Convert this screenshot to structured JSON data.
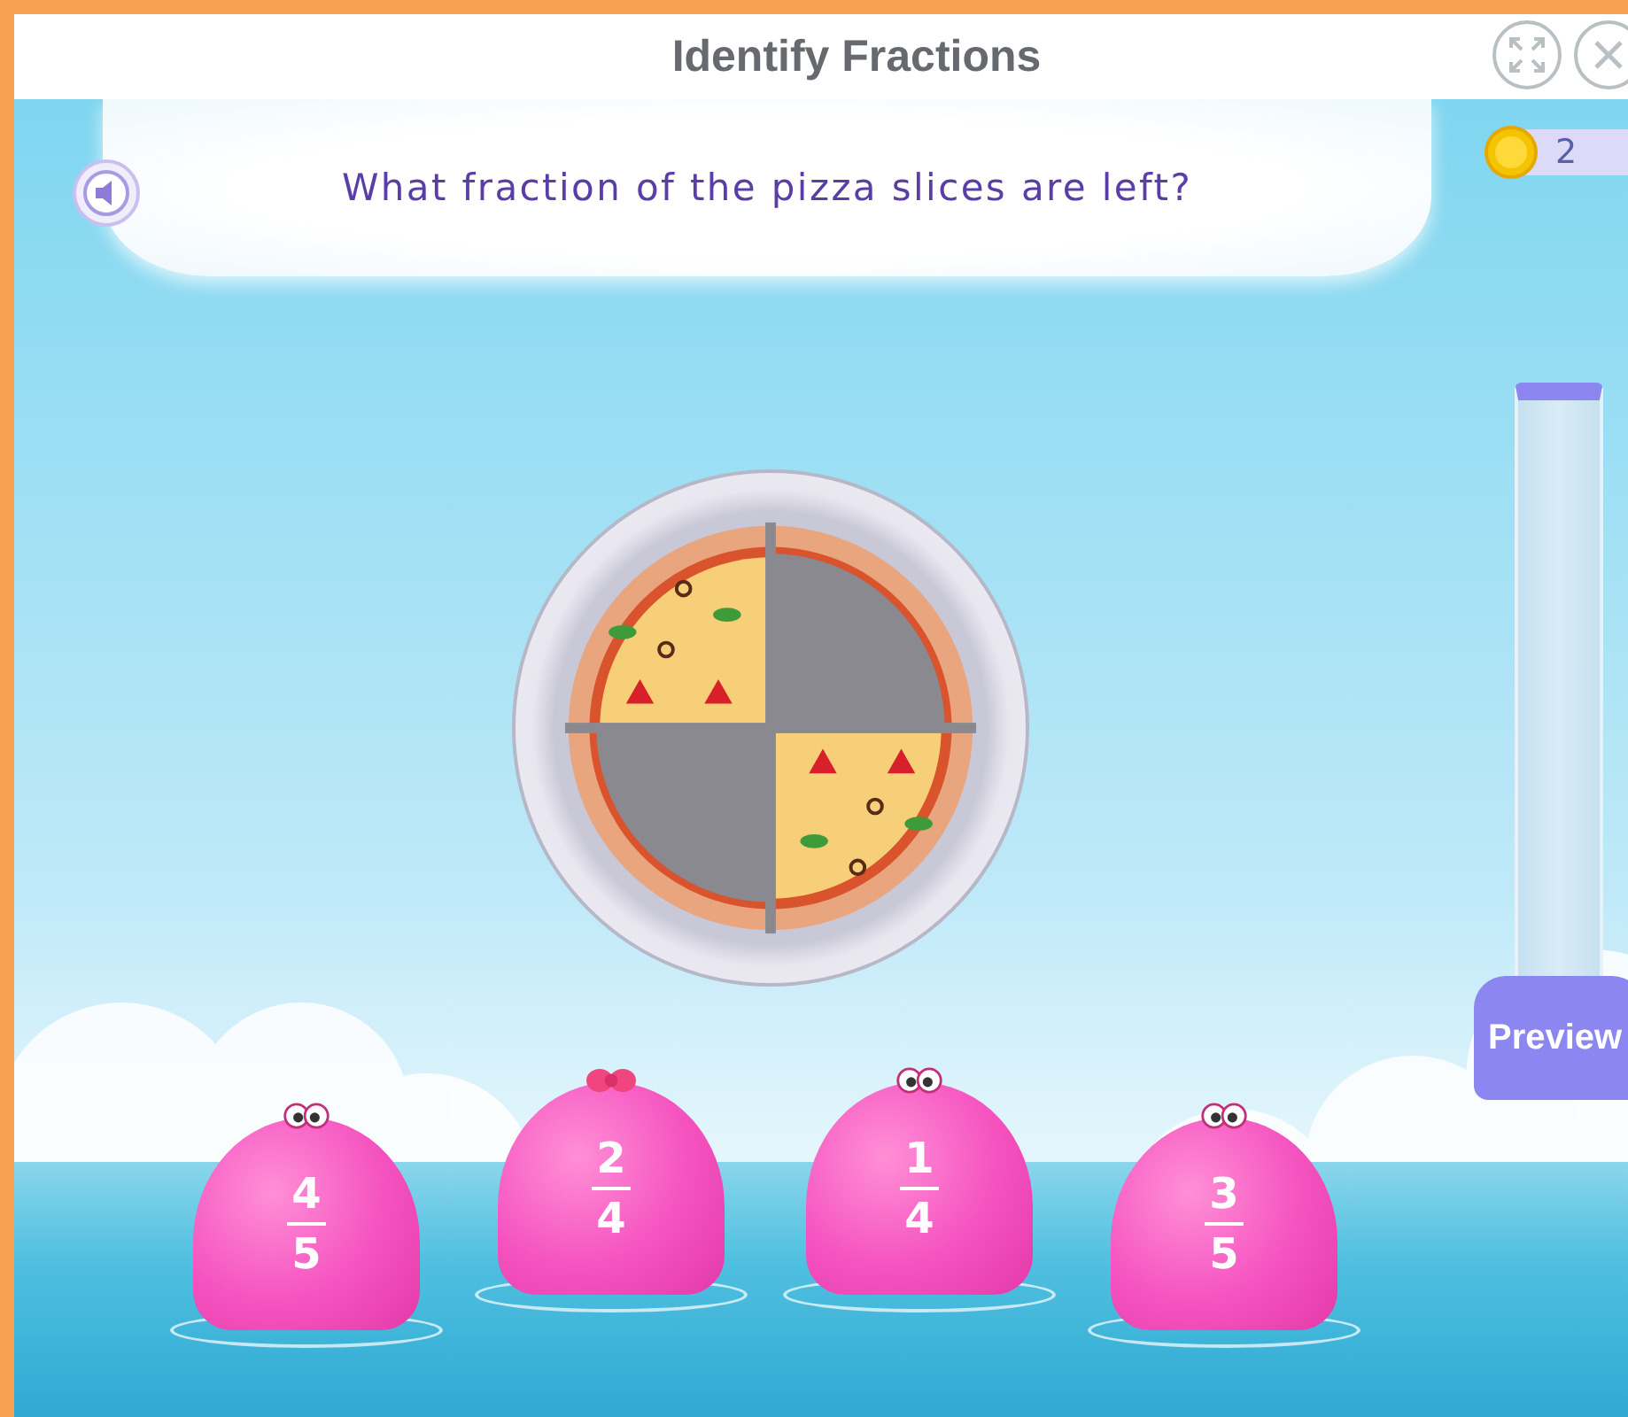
{
  "window": {
    "title": "Identify Fractions"
  },
  "question": "What fraction of the pizza slices are left?",
  "coins": "2",
  "pizza": {
    "slices": [
      {
        "eaten": false
      },
      {
        "eaten": true
      },
      {
        "eaten": true
      },
      {
        "eaten": false
      }
    ]
  },
  "preview": {
    "label": "Preview"
  },
  "answers": [
    {
      "kind": "eyes",
      "numerator": "4",
      "denominator": "5"
    },
    {
      "kind": "bow",
      "numerator": "2",
      "denominator": "4"
    },
    {
      "kind": "eyes",
      "numerator": "1",
      "denominator": "4"
    },
    {
      "kind": "eyes",
      "numerator": "3",
      "denominator": "5"
    }
  ]
}
